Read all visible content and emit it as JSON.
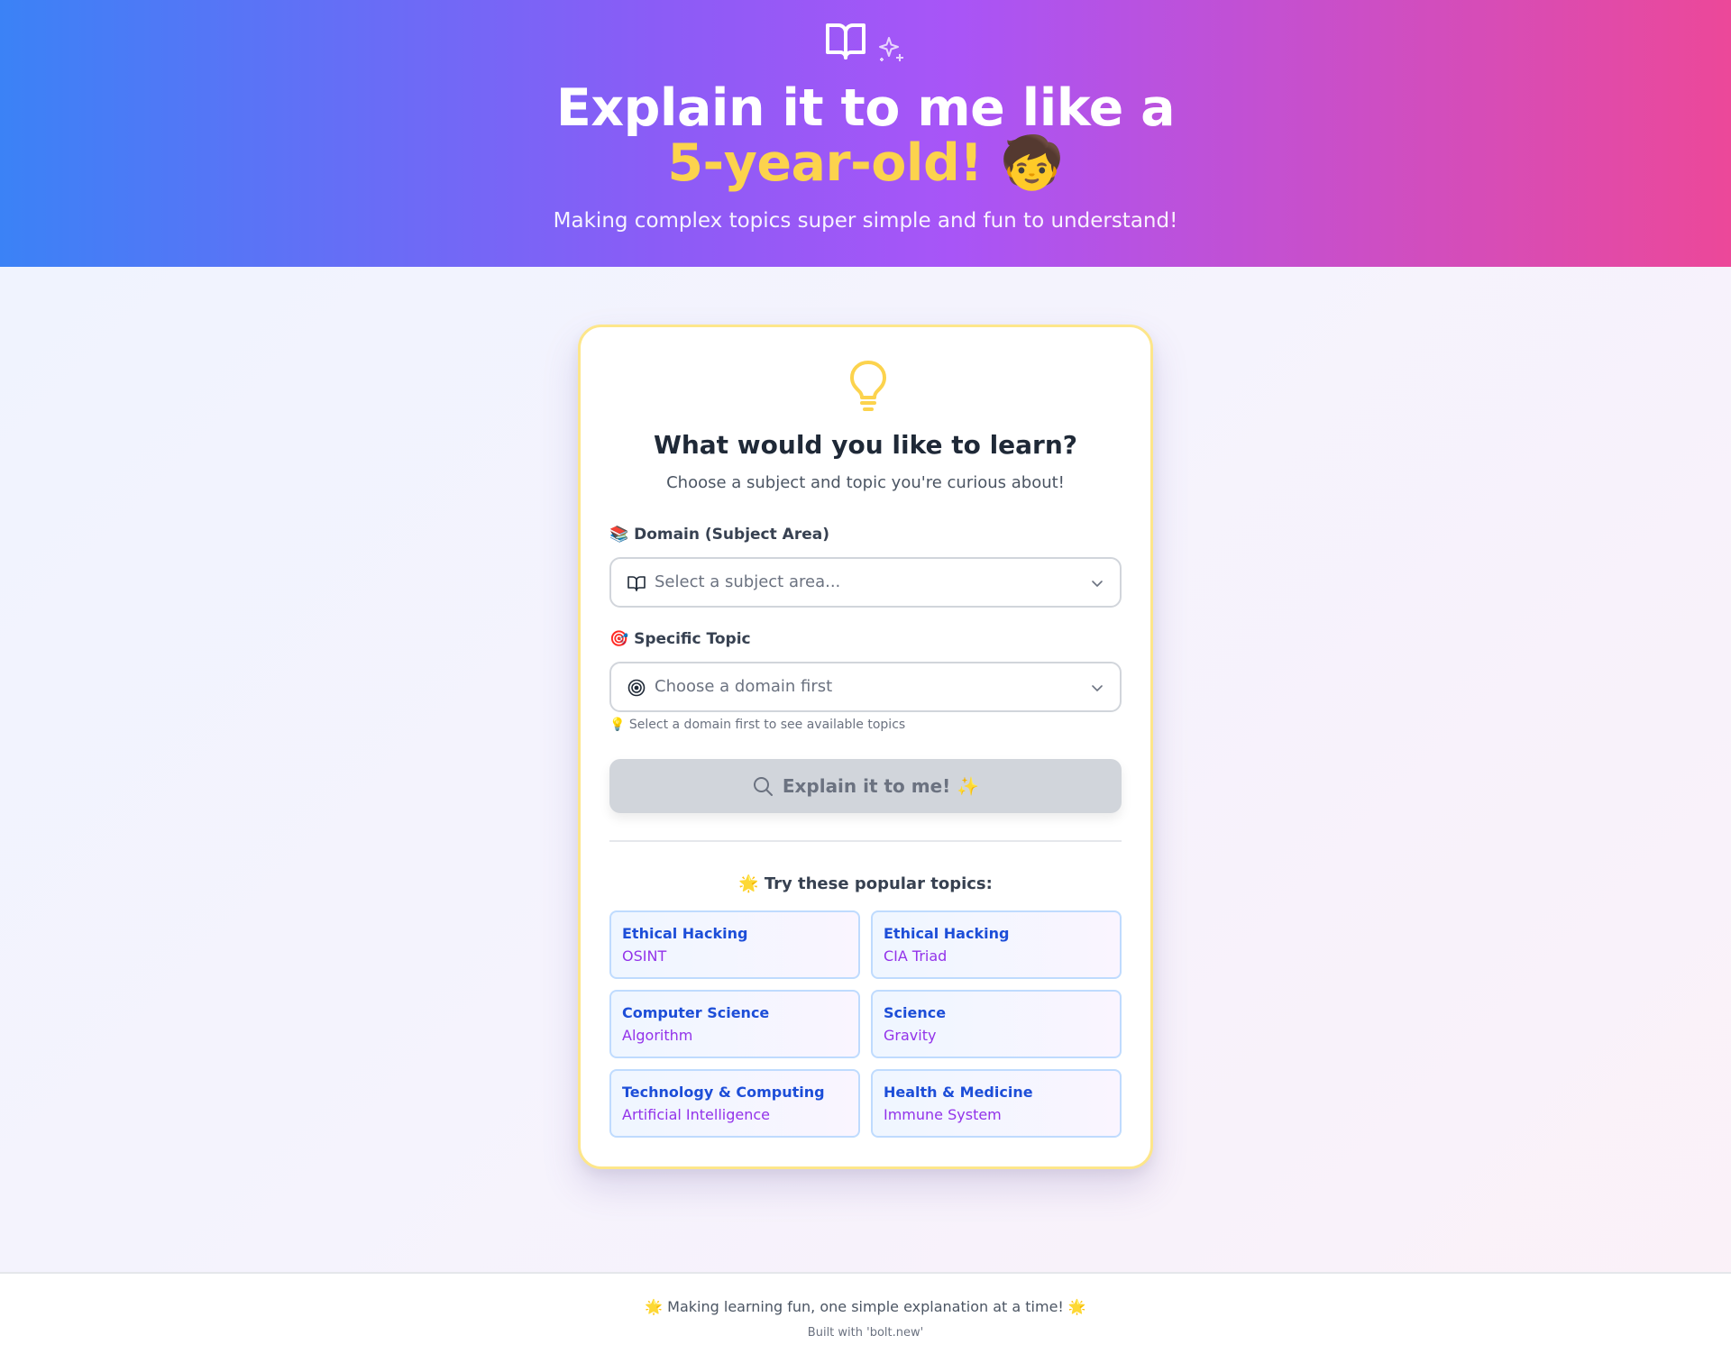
{
  "hero": {
    "title_line1": "Explain it to me like a",
    "title_accent": "5-year-old!",
    "title_emoji": "🧒",
    "subtitle": "Making complex topics super simple and fun to understand!",
    "icons": [
      "book-open-icon",
      "sparkles-icon"
    ],
    "gradient_colors": [
      "#3b82f6",
      "#a855f7",
      "#ec4899"
    ],
    "accent_color": "#fcd34d"
  },
  "card": {
    "icon": "lightbulb-icon",
    "title": "What would you like to learn?",
    "subtitle": "Choose a subject and topic you're curious about!",
    "border_color": "#fde68a"
  },
  "form": {
    "domain_label": "📚 Domain (Subject Area)",
    "domain_placeholder": "Select a subject area...",
    "domain_icon": "book-open-icon",
    "topic_label": "🎯 Specific Topic",
    "topic_placeholder": "Choose a domain first",
    "topic_icon": "target-icon",
    "hint": "💡 Select a domain first to see available topics",
    "submit_label": "Explain it to me! ✨",
    "submit_icon": "search-icon"
  },
  "popular": {
    "title": "🌟 Try these popular topics:",
    "topics": [
      {
        "domain": "Ethical Hacking",
        "topic": "OSINT"
      },
      {
        "domain": "Ethical Hacking",
        "topic": "CIA Triad"
      },
      {
        "domain": "Computer Science",
        "topic": "Algorithm"
      },
      {
        "domain": "Science",
        "topic": "Gravity"
      },
      {
        "domain": "Technology & Computing",
        "topic": "Artificial Intelligence"
      },
      {
        "domain": "Health & Medicine",
        "topic": "Immune System"
      }
    ]
  },
  "footer": {
    "tagline": "🌟 Making learning fun, one simple explanation at a time! 🌟",
    "built_with": "Built with 'bolt.new'"
  }
}
